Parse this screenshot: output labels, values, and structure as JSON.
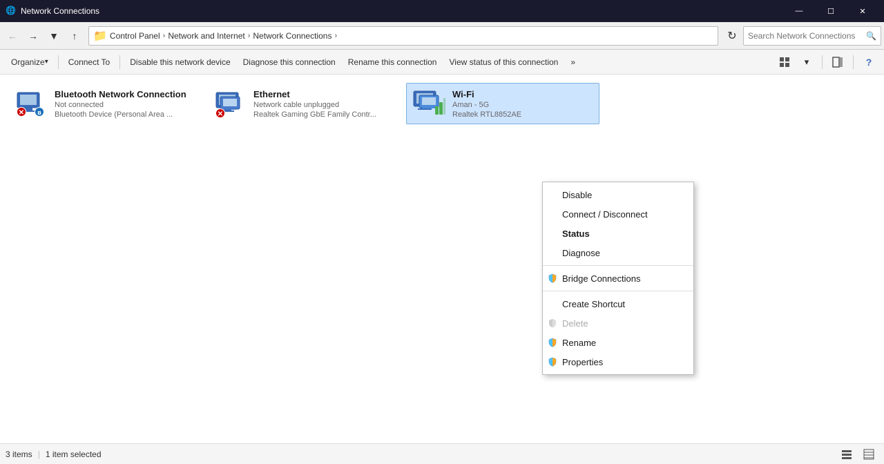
{
  "titlebar": {
    "title": "Network Connections",
    "icon": "🌐",
    "min": "—",
    "max": "☐",
    "close": "✕"
  },
  "addressbar": {
    "back_tooltip": "Back",
    "forward_tooltip": "Forward",
    "up_tooltip": "Up",
    "dropdown_tooltip": "Recent locations",
    "breadcrumbs": [
      "Control Panel",
      "Network and Internet",
      "Network Connections"
    ],
    "search_placeholder": "Search Network Connections",
    "refresh": "↻"
  },
  "toolbar": {
    "organize": "Organize",
    "connect_to": "Connect To",
    "disable": "Disable this network device",
    "diagnose": "Diagnose this connection",
    "rename": "Rename this connection",
    "view_status": "View status of this connection",
    "more": "»"
  },
  "connections": [
    {
      "id": "bluetooth",
      "name": "Bluetooth Network Connection",
      "status": "Not connected",
      "device": "Bluetooth Device (Personal Area ...",
      "selected": false,
      "icon_type": "bluetooth"
    },
    {
      "id": "ethernet",
      "name": "Ethernet",
      "status": "Network cable unplugged",
      "device": "Realtek Gaming GbE Family Contr...",
      "selected": false,
      "icon_type": "ethernet"
    },
    {
      "id": "wifi",
      "name": "Wi-Fi",
      "status": "Aman - 5G",
      "device": "Realtek RTL8852AE",
      "selected": true,
      "icon_type": "wifi"
    }
  ],
  "context_menu": {
    "visible": true,
    "items": [
      {
        "id": "disable",
        "label": "Disable",
        "bold": false,
        "disabled": false,
        "has_icon": false,
        "sep_before": false
      },
      {
        "id": "connect_disconnect",
        "label": "Connect / Disconnect",
        "bold": false,
        "disabled": false,
        "has_icon": false,
        "sep_before": false
      },
      {
        "id": "status",
        "label": "Status",
        "bold": true,
        "disabled": false,
        "has_icon": false,
        "sep_before": false
      },
      {
        "id": "diagnose",
        "label": "Diagnose",
        "bold": false,
        "disabled": false,
        "has_icon": false,
        "sep_before": false
      },
      {
        "id": "bridge",
        "label": "Bridge Connections",
        "bold": false,
        "disabled": false,
        "has_icon": true,
        "sep_before": true
      },
      {
        "id": "create_shortcut",
        "label": "Create Shortcut",
        "bold": false,
        "disabled": false,
        "has_icon": false,
        "sep_before": true
      },
      {
        "id": "delete",
        "label": "Delete",
        "bold": false,
        "disabled": true,
        "has_icon": true,
        "sep_before": false
      },
      {
        "id": "rename",
        "label": "Rename",
        "bold": false,
        "disabled": false,
        "has_icon": true,
        "sep_before": false
      },
      {
        "id": "properties",
        "label": "Properties",
        "bold": false,
        "disabled": false,
        "has_icon": true,
        "sep_before": false
      }
    ]
  },
  "statusbar": {
    "count": "3 items",
    "selected": "1 item selected"
  }
}
